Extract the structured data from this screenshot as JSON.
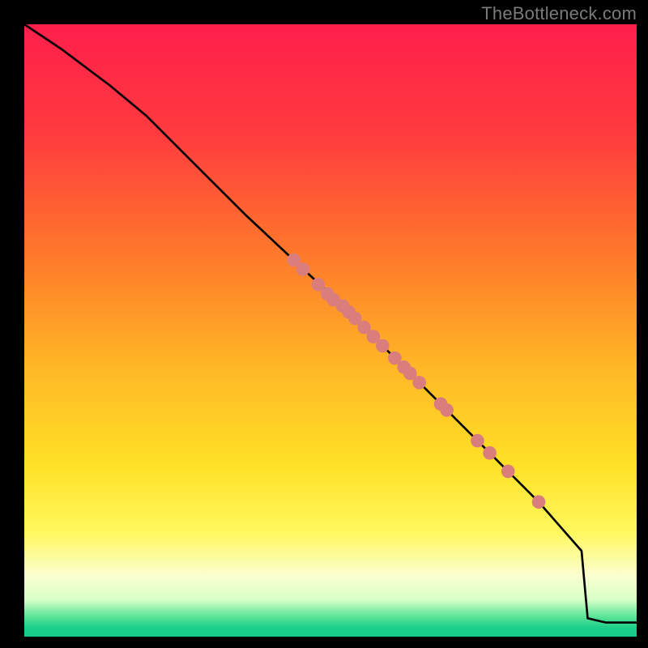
{
  "watermark": "TheBottleneck.com",
  "colors": {
    "frame": "#000000",
    "watermark": "#7a7a7a",
    "curve": "#000000",
    "marker": "#d97d7d",
    "gradient_stops": [
      {
        "offset": 0.0,
        "color": "#ff1f4b"
      },
      {
        "offset": 0.18,
        "color": "#ff3b3f"
      },
      {
        "offset": 0.38,
        "color": "#ff7a2a"
      },
      {
        "offset": 0.56,
        "color": "#ffb726"
      },
      {
        "offset": 0.72,
        "color": "#ffe126"
      },
      {
        "offset": 0.83,
        "color": "#fff85e"
      },
      {
        "offset": 0.9,
        "color": "#fbffd0"
      },
      {
        "offset": 0.94,
        "color": "#d7ffc6"
      },
      {
        "offset": 0.965,
        "color": "#63e79a"
      },
      {
        "offset": 0.985,
        "color": "#1dcf8a"
      },
      {
        "offset": 1.0,
        "color": "#14c888"
      }
    ]
  },
  "chart_data": {
    "type": "line",
    "title": "",
    "xlabel": "",
    "ylabel": "",
    "xlim": [
      0,
      100
    ],
    "ylim": [
      0,
      100
    ],
    "series": [
      {
        "name": "curve",
        "x": [
          0,
          3,
          6,
          10,
          14,
          20,
          28,
          36,
          44,
          52,
          60,
          68,
          76,
          84,
          91,
          92,
          95,
          100
        ],
        "y": [
          100,
          98,
          96,
          93,
          90,
          85,
          77,
          69,
          61.5,
          54,
          46,
          38,
          30,
          22,
          14,
          3,
          2.3,
          2.3
        ]
      }
    ],
    "markers": {
      "name": "points",
      "x": [
        44,
        45.5,
        48,
        49.5,
        50.5,
        52,
        53,
        54,
        55.5,
        57,
        58.5,
        60.5,
        62,
        63,
        64.5,
        68,
        69,
        74,
        76,
        79,
        84
      ],
      "y": [
        61.5,
        60,
        57.5,
        56,
        55,
        54,
        53,
        52,
        50.5,
        49,
        47.5,
        45.5,
        44,
        43,
        41.5,
        38,
        37,
        32,
        30,
        27,
        22
      ],
      "r": 1.1
    }
  }
}
